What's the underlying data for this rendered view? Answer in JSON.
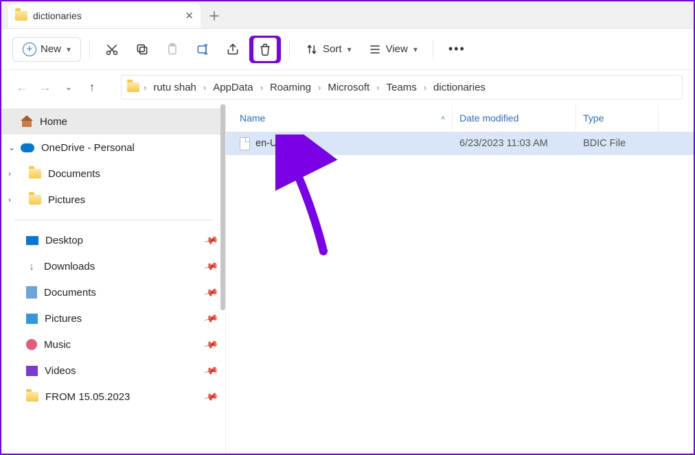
{
  "tab": {
    "title": "dictionaries"
  },
  "toolbar": {
    "new_label": "New",
    "sort_label": "Sort",
    "view_label": "View"
  },
  "breadcrumb": [
    "rutu shah",
    "AppData",
    "Roaming",
    "Microsoft",
    "Teams",
    "dictionaries"
  ],
  "sidebar": {
    "home": "Home",
    "onedrive": "OneDrive - Personal",
    "one_children": [
      "Documents",
      "Pictures"
    ],
    "pinned": [
      {
        "label": "Desktop"
      },
      {
        "label": "Downloads"
      },
      {
        "label": "Documents"
      },
      {
        "label": "Pictures"
      },
      {
        "label": "Music"
      },
      {
        "label": "Videos"
      },
      {
        "label": "FROM 15.05.2023"
      }
    ]
  },
  "columns": {
    "name": "Name",
    "date": "Date modified",
    "type": "Type"
  },
  "files": [
    {
      "name": "en-US.bdic",
      "date": "6/23/2023 11:03 AM",
      "type": "BDIC File"
    }
  ]
}
